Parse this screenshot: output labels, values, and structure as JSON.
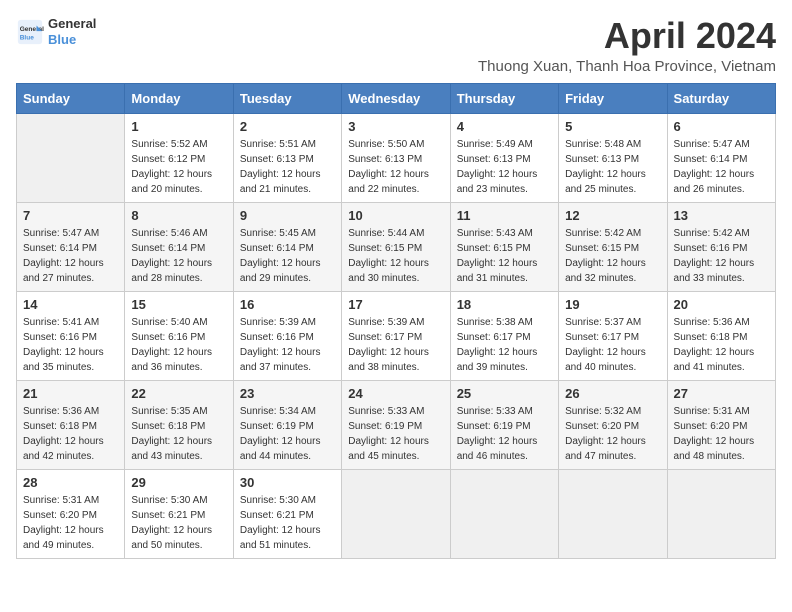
{
  "app": {
    "logo_line1": "General",
    "logo_line2": "Blue"
  },
  "calendar": {
    "month_title": "April 2024",
    "subtitle": "Thuong Xuan, Thanh Hoa Province, Vietnam",
    "days_of_week": [
      "Sunday",
      "Monday",
      "Tuesday",
      "Wednesday",
      "Thursday",
      "Friday",
      "Saturday"
    ],
    "weeks": [
      [
        {
          "day": "",
          "empty": true
        },
        {
          "day": "1",
          "sunrise": "5:52 AM",
          "sunset": "6:12 PM",
          "daylight": "12 hours and 20 minutes."
        },
        {
          "day": "2",
          "sunrise": "5:51 AM",
          "sunset": "6:13 PM",
          "daylight": "12 hours and 21 minutes."
        },
        {
          "day": "3",
          "sunrise": "5:50 AM",
          "sunset": "6:13 PM",
          "daylight": "12 hours and 22 minutes."
        },
        {
          "day": "4",
          "sunrise": "5:49 AM",
          "sunset": "6:13 PM",
          "daylight": "12 hours and 23 minutes."
        },
        {
          "day": "5",
          "sunrise": "5:48 AM",
          "sunset": "6:13 PM",
          "daylight": "12 hours and 25 minutes."
        },
        {
          "day": "6",
          "sunrise": "5:47 AM",
          "sunset": "6:14 PM",
          "daylight": "12 hours and 26 minutes."
        }
      ],
      [
        {
          "day": "7",
          "sunrise": "5:47 AM",
          "sunset": "6:14 PM",
          "daylight": "12 hours and 27 minutes."
        },
        {
          "day": "8",
          "sunrise": "5:46 AM",
          "sunset": "6:14 PM",
          "daylight": "12 hours and 28 minutes."
        },
        {
          "day": "9",
          "sunrise": "5:45 AM",
          "sunset": "6:14 PM",
          "daylight": "12 hours and 29 minutes."
        },
        {
          "day": "10",
          "sunrise": "5:44 AM",
          "sunset": "6:15 PM",
          "daylight": "12 hours and 30 minutes."
        },
        {
          "day": "11",
          "sunrise": "5:43 AM",
          "sunset": "6:15 PM",
          "daylight": "12 hours and 31 minutes."
        },
        {
          "day": "12",
          "sunrise": "5:42 AM",
          "sunset": "6:15 PM",
          "daylight": "12 hours and 32 minutes."
        },
        {
          "day": "13",
          "sunrise": "5:42 AM",
          "sunset": "6:16 PM",
          "daylight": "12 hours and 33 minutes."
        }
      ],
      [
        {
          "day": "14",
          "sunrise": "5:41 AM",
          "sunset": "6:16 PM",
          "daylight": "12 hours and 35 minutes."
        },
        {
          "day": "15",
          "sunrise": "5:40 AM",
          "sunset": "6:16 PM",
          "daylight": "12 hours and 36 minutes."
        },
        {
          "day": "16",
          "sunrise": "5:39 AM",
          "sunset": "6:16 PM",
          "daylight": "12 hours and 37 minutes."
        },
        {
          "day": "17",
          "sunrise": "5:39 AM",
          "sunset": "6:17 PM",
          "daylight": "12 hours and 38 minutes."
        },
        {
          "day": "18",
          "sunrise": "5:38 AM",
          "sunset": "6:17 PM",
          "daylight": "12 hours and 39 minutes."
        },
        {
          "day": "19",
          "sunrise": "5:37 AM",
          "sunset": "6:17 PM",
          "daylight": "12 hours and 40 minutes."
        },
        {
          "day": "20",
          "sunrise": "5:36 AM",
          "sunset": "6:18 PM",
          "daylight": "12 hours and 41 minutes."
        }
      ],
      [
        {
          "day": "21",
          "sunrise": "5:36 AM",
          "sunset": "6:18 PM",
          "daylight": "12 hours and 42 minutes."
        },
        {
          "day": "22",
          "sunrise": "5:35 AM",
          "sunset": "6:18 PM",
          "daylight": "12 hours and 43 minutes."
        },
        {
          "day": "23",
          "sunrise": "5:34 AM",
          "sunset": "6:19 PM",
          "daylight": "12 hours and 44 minutes."
        },
        {
          "day": "24",
          "sunrise": "5:33 AM",
          "sunset": "6:19 PM",
          "daylight": "12 hours and 45 minutes."
        },
        {
          "day": "25",
          "sunrise": "5:33 AM",
          "sunset": "6:19 PM",
          "daylight": "12 hours and 46 minutes."
        },
        {
          "day": "26",
          "sunrise": "5:32 AM",
          "sunset": "6:20 PM",
          "daylight": "12 hours and 47 minutes."
        },
        {
          "day": "27",
          "sunrise": "5:31 AM",
          "sunset": "6:20 PM",
          "daylight": "12 hours and 48 minutes."
        }
      ],
      [
        {
          "day": "28",
          "sunrise": "5:31 AM",
          "sunset": "6:20 PM",
          "daylight": "12 hours and 49 minutes."
        },
        {
          "day": "29",
          "sunrise": "5:30 AM",
          "sunset": "6:21 PM",
          "daylight": "12 hours and 50 minutes."
        },
        {
          "day": "30",
          "sunrise": "5:30 AM",
          "sunset": "6:21 PM",
          "daylight": "12 hours and 51 minutes."
        },
        {
          "day": "",
          "empty": true
        },
        {
          "day": "",
          "empty": true
        },
        {
          "day": "",
          "empty": true
        },
        {
          "day": "",
          "empty": true
        }
      ]
    ],
    "sunrise_label": "Sunrise:",
    "sunset_label": "Sunset:",
    "daylight_label": "Daylight:"
  }
}
